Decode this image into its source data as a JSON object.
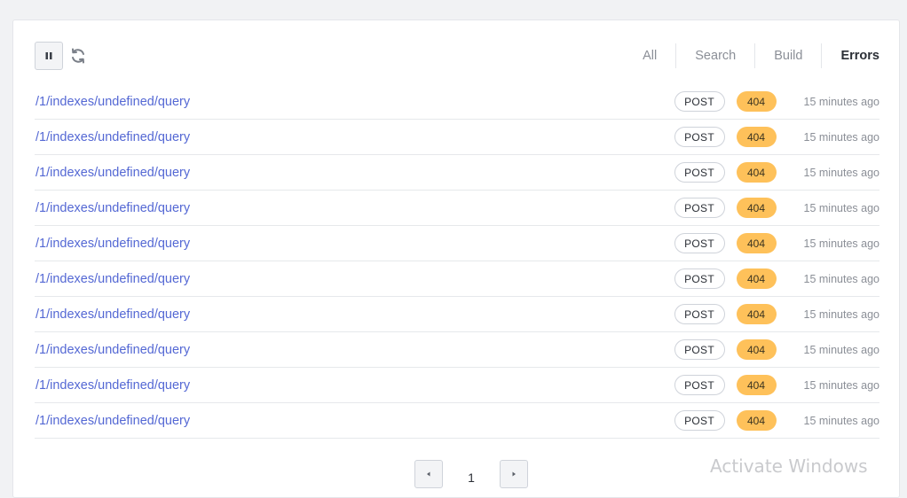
{
  "toolbar": {
    "pause_icon": "pause-icon",
    "refresh_icon": "refresh-icon"
  },
  "tabs": [
    {
      "label": "All",
      "active": false
    },
    {
      "label": "Search",
      "active": false
    },
    {
      "label": "Build",
      "active": false
    },
    {
      "label": "Errors",
      "active": true
    }
  ],
  "rows": [
    {
      "path": "/1/indexes/undefined/query",
      "method": "POST",
      "status": "404",
      "time": "15 minutes ago"
    },
    {
      "path": "/1/indexes/undefined/query",
      "method": "POST",
      "status": "404",
      "time": "15 minutes ago"
    },
    {
      "path": "/1/indexes/undefined/query",
      "method": "POST",
      "status": "404",
      "time": "15 minutes ago"
    },
    {
      "path": "/1/indexes/undefined/query",
      "method": "POST",
      "status": "404",
      "time": "15 minutes ago"
    },
    {
      "path": "/1/indexes/undefined/query",
      "method": "POST",
      "status": "404",
      "time": "15 minutes ago"
    },
    {
      "path": "/1/indexes/undefined/query",
      "method": "POST",
      "status": "404",
      "time": "15 minutes ago"
    },
    {
      "path": "/1/indexes/undefined/query",
      "method": "POST",
      "status": "404",
      "time": "15 minutes ago"
    },
    {
      "path": "/1/indexes/undefined/query",
      "method": "POST",
      "status": "404",
      "time": "15 minutes ago"
    },
    {
      "path": "/1/indexes/undefined/query",
      "method": "POST",
      "status": "404",
      "time": "15 minutes ago"
    },
    {
      "path": "/1/indexes/undefined/query",
      "method": "POST",
      "status": "404",
      "time": "15 minutes ago"
    }
  ],
  "pagination": {
    "current_page": "1",
    "prev_icon": "caret-left-icon",
    "next_icon": "caret-right-icon"
  },
  "watermark": "Activate Windows",
  "colors": {
    "accent": "#5468d4",
    "status_warning": "#fec15a",
    "background": "#f1f2f4"
  }
}
